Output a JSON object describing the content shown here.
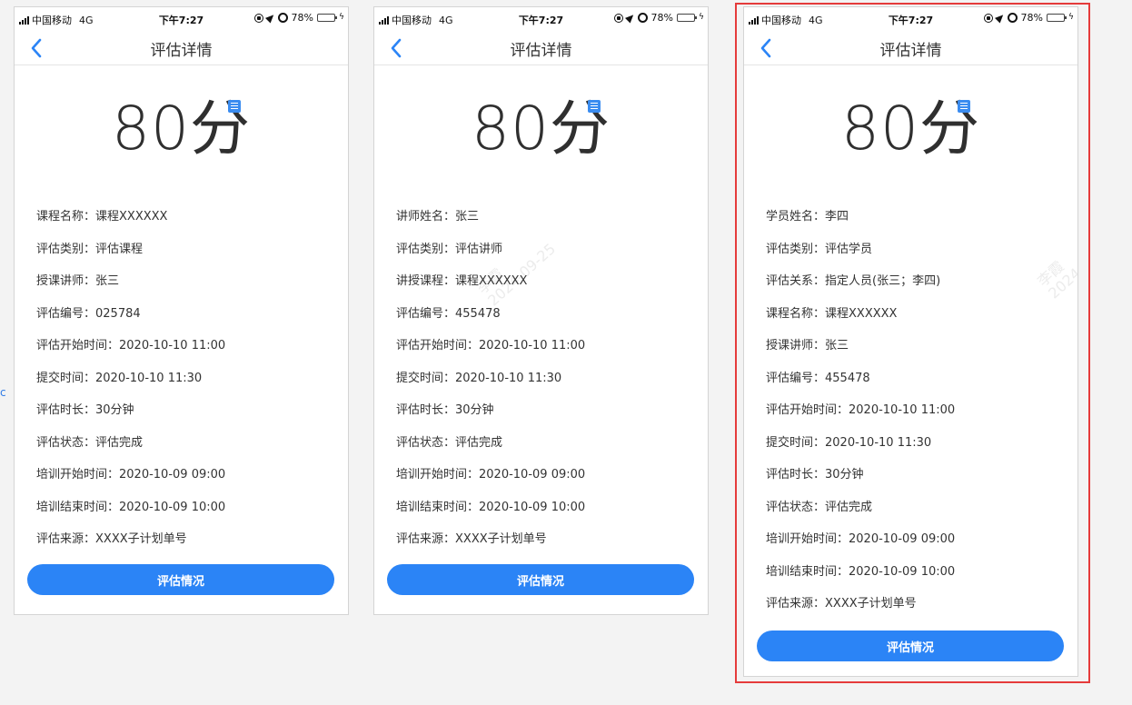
{
  "status": {
    "carrier": "中国移动",
    "network": "4G",
    "time": "下午7:27",
    "battery_pct": "78%",
    "battery_level": 0.78
  },
  "nav": {
    "title": "评估详情"
  },
  "score": {
    "value": "80分"
  },
  "watermark": {
    "name": "李霞",
    "date": "2024-09-25"
  },
  "screens": [
    {
      "fields": [
        {
          "label": "课程名称：",
          "value": "课程XXXXXX"
        },
        {
          "label": "评估类别：",
          "value": "评估课程"
        },
        {
          "label": "授课讲师：",
          "value": "张三"
        },
        {
          "label": "评估编号：",
          "value": "025784"
        },
        {
          "label": "评估开始时间：",
          "value": "2020-10-10 11:00"
        },
        {
          "label": "提交时间：",
          "value": "2020-10-10 11:30"
        },
        {
          "label": "评估时长：",
          "value": "30分钟"
        },
        {
          "label": "评估状态：",
          "value": "评估完成"
        },
        {
          "label": "培训开始时间：",
          "value": "2020-10-09 09:00"
        },
        {
          "label": "培训结束时间：",
          "value": "2020-10-09 10:00"
        },
        {
          "label": "评估来源：",
          "value": "XXXX子计划单号"
        }
      ],
      "button_label": "评估情况"
    },
    {
      "fields": [
        {
          "label": "讲师姓名：",
          "value": "张三"
        },
        {
          "label": "评估类别：",
          "value": "评估讲师"
        },
        {
          "label": "讲授课程：",
          "value": "课程XXXXXX"
        },
        {
          "label": "评估编号：",
          "value": "455478"
        },
        {
          "label": "评估开始时间：",
          "value": "2020-10-10 11:00"
        },
        {
          "label": "提交时间：",
          "value": "2020-10-10 11:30"
        },
        {
          "label": "评估时长：",
          "value": "30分钟"
        },
        {
          "label": "评估状态：",
          "value": "评估完成"
        },
        {
          "label": "培训开始时间：",
          "value": "2020-10-09 09:00"
        },
        {
          "label": "培训结束时间：",
          "value": "2020-10-09 10:00"
        },
        {
          "label": "评估来源：",
          "value": "XXXX子计划单号"
        }
      ],
      "button_label": "评估情况"
    },
    {
      "fields": [
        {
          "label": "学员姓名：",
          "value": "李四"
        },
        {
          "label": "评估类别：",
          "value": "评估学员"
        },
        {
          "label": "评估关系：",
          "value": "指定人员(张三；李四)"
        },
        {
          "label": "课程名称：",
          "value": "课程XXXXXX"
        },
        {
          "label": "授课讲师：",
          "value": "张三"
        },
        {
          "label": "评估编号：",
          "value": "455478"
        },
        {
          "label": "评估开始时间：",
          "value": "2020-10-10 11:00"
        },
        {
          "label": "提交时间：",
          "value": "2020-10-10 11:30"
        },
        {
          "label": "评估时长：",
          "value": "30分钟"
        },
        {
          "label": "评估状态：",
          "value": "评估完成"
        },
        {
          "label": "培训开始时间：",
          "value": "2020-10-09 09:00"
        },
        {
          "label": "培训结束时间：",
          "value": "2020-10-09 10:00"
        },
        {
          "label": "评估来源：",
          "value": "XXXX子计划单号"
        }
      ],
      "button_label": "评估情况"
    }
  ],
  "colors": {
    "accent": "#2b84f6",
    "selection_outline": "#e53b3b",
    "battery": "#f4c72b"
  }
}
